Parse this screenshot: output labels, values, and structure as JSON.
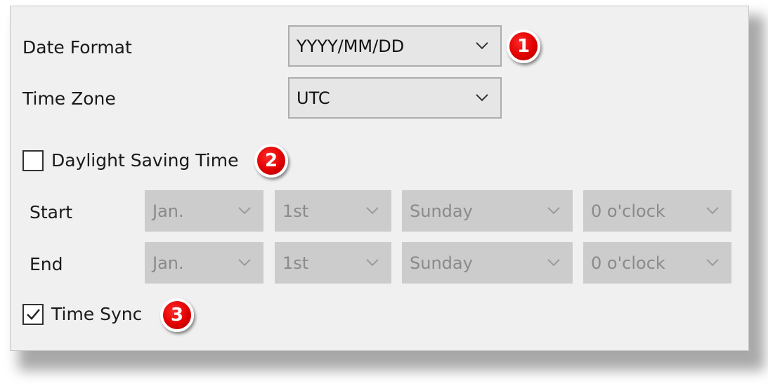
{
  "date_format": {
    "label": "Date Format",
    "value": "YYYY/MM/DD",
    "callout": "1"
  },
  "time_zone": {
    "label": "Time Zone",
    "value": "UTC"
  },
  "dst": {
    "label": "Daylight Saving Time",
    "checked": false,
    "callout": "2",
    "start": {
      "label": "Start",
      "month": "Jan.",
      "week": "1st",
      "day": "Sunday",
      "hour": "0 o'clock"
    },
    "end": {
      "label": "End",
      "month": "Jan.",
      "week": "1st",
      "day": "Sunday",
      "hour": "0 o'clock"
    }
  },
  "time_sync": {
    "label": "Time Sync",
    "checked": true,
    "callout": "3"
  },
  "colors": {
    "panel_bg": "#f0f0f0",
    "callout_red": "#e00000",
    "disabled_bg": "#cccccc",
    "disabled_text": "#8a8a8a"
  },
  "icons": {
    "dropdown": "chevron-down-icon",
    "check": "checkmark-icon"
  }
}
